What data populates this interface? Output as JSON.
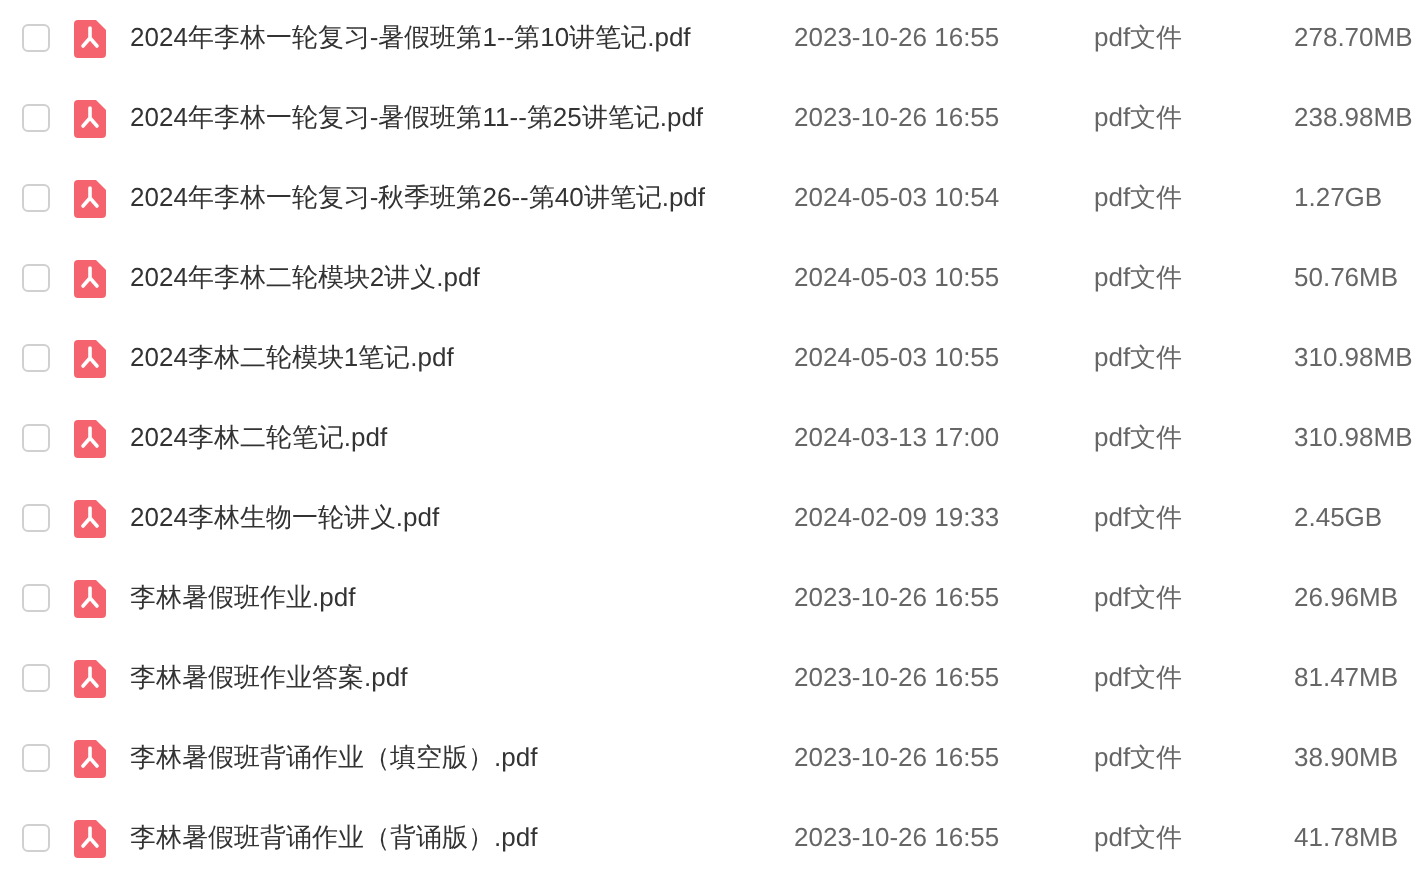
{
  "files": [
    {
      "name": "2024年李林一轮复习-暑假班第1--第10讲笔记.pdf",
      "checked": false,
      "date": "2023-10-26 16:55",
      "type": "pdf文件",
      "size": "278.70MB"
    },
    {
      "name": "2024年李林一轮复习-暑假班第11--第25讲笔记.pdf",
      "checked": false,
      "date": "2023-10-26 16:55",
      "type": "pdf文件",
      "size": "238.98MB"
    },
    {
      "name": "2024年李林一轮复习-秋季班第26--第40讲笔记.pdf",
      "checked": false,
      "date": "2024-05-03 10:54",
      "type": "pdf文件",
      "size": "1.27GB"
    },
    {
      "name": "2024年李林二轮模块2讲义.pdf",
      "checked": false,
      "date": "2024-05-03 10:55",
      "type": "pdf文件",
      "size": "50.76MB"
    },
    {
      "name": "2024李林二轮模块1笔记.pdf",
      "checked": false,
      "date": "2024-05-03 10:55",
      "type": "pdf文件",
      "size": "310.98MB"
    },
    {
      "name": "2024李林二轮笔记.pdf",
      "checked": false,
      "date": "2024-03-13 17:00",
      "type": "pdf文件",
      "size": "310.98MB"
    },
    {
      "name": "2024李林生物一轮讲义.pdf",
      "checked": false,
      "date": "2024-02-09 19:33",
      "type": "pdf文件",
      "size": "2.45GB"
    },
    {
      "name": "李林暑假班作业.pdf",
      "checked": false,
      "date": "2023-10-26 16:55",
      "type": "pdf文件",
      "size": "26.96MB"
    },
    {
      "name": "李林暑假班作业答案.pdf",
      "checked": false,
      "date": "2023-10-26 16:55",
      "type": "pdf文件",
      "size": "81.47MB"
    },
    {
      "name": "李林暑假班背诵作业（填空版）.pdf",
      "checked": false,
      "date": "2023-10-26 16:55",
      "type": "pdf文件",
      "size": "38.90MB"
    },
    {
      "name": "李林暑假班背诵作业（背诵版）.pdf",
      "checked": false,
      "date": "2023-10-26 16:55",
      "type": "pdf文件",
      "size": "41.78MB"
    }
  ]
}
